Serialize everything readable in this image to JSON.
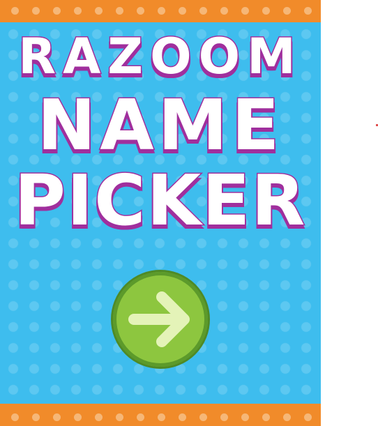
{
  "title": {
    "line1": "RAZOOM",
    "line2": "NAME",
    "line3": "PICKER"
  },
  "start_button": {
    "icon": "arrow-right-icon"
  },
  "colors": {
    "background": "#3ebdee",
    "stripe": "#f18b2a",
    "stripe_dot": "#f6b777",
    "title_fill": "#ffffff",
    "title_outline": "#a02f9d",
    "button_fill": "#8dc63f",
    "button_outline": "#4f8a26",
    "arrow": "#e4f3b8"
  }
}
